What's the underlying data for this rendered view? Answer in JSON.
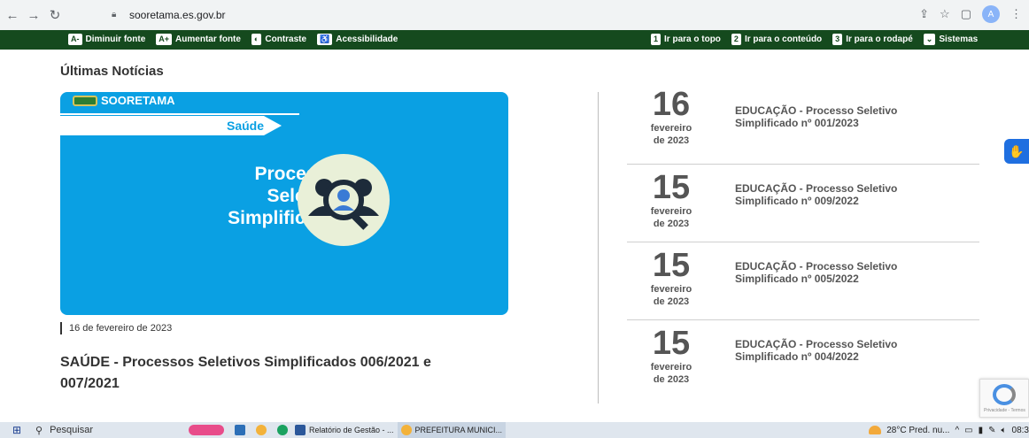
{
  "browser": {
    "url": "sooretama.es.gov.br",
    "profile_initial": "A"
  },
  "accessibility": {
    "left": [
      {
        "badge": "A-",
        "label": "Diminuir fonte"
      },
      {
        "badge": "A+",
        "label": "Aumentar fonte"
      },
      {
        "badge": "◐",
        "label": "Contraste"
      },
      {
        "badge": "♿",
        "label": "Acessibilidade"
      }
    ],
    "right": [
      {
        "badge": "1",
        "label": "Ir para o topo"
      },
      {
        "badge": "2",
        "label": "Ir para o conteúdo"
      },
      {
        "badge": "3",
        "label": "Ir para o rodapé"
      },
      {
        "badge": "⌄",
        "label": "Sistemas"
      }
    ]
  },
  "news_section": {
    "title": "Últimas Notícias",
    "featured": {
      "brand": "SOORETAMA",
      "tag": "Saúde",
      "headline_lines": [
        "Processo",
        "Seletivo",
        "Simplificado"
      ],
      "date": "16 de fevereiro de 2023",
      "title": "SAÚDE - Processos Seletivos Simplificados 006/2021 e 007/2021"
    },
    "items": [
      {
        "day": "16",
        "month": "fevereiro",
        "year": "de 2023",
        "title": "EDUCAÇÃO - Processo Seletivo Simplificado nº 001/2023"
      },
      {
        "day": "15",
        "month": "fevereiro",
        "year": "de 2023",
        "title": "EDUCAÇÃO - Processo Seletivo Simplificado nº 009/2022"
      },
      {
        "day": "15",
        "month": "fevereiro",
        "year": "de 2023",
        "title": "EDUCAÇÃO - Processo Seletivo Simplificado nº 005/2022"
      },
      {
        "day": "15",
        "month": "fevereiro",
        "year": "de 2023",
        "title": "EDUCAÇÃO - Processo Seletivo Simplificado nº 004/2022"
      }
    ]
  },
  "recaptcha": {
    "footer": "Privacidade - Termos"
  },
  "taskbar": {
    "search_placeholder": "Pesquisar",
    "apps": [
      {
        "label": "Relatório de Gestão - ..."
      },
      {
        "label": "PREFEITURA MUNICI..."
      }
    ],
    "weather": "28°C Pred. nu...",
    "time": "08:3"
  },
  "colors": {
    "accessibility_bar": "#154a1e",
    "card_blue": "#0aa0e3"
  }
}
